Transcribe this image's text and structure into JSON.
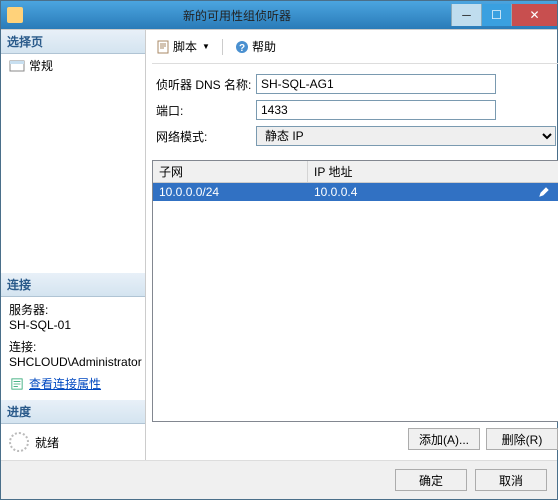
{
  "window": {
    "title": "新的可用性组侦听器"
  },
  "left": {
    "select_page": "选择页",
    "nav_general": "常规",
    "connection_hdr": "连接",
    "server_lbl": "服务器:",
    "server_val": "SH-SQL-01",
    "conn_lbl": "连接:",
    "conn_val": "SHCLOUD\\Administrator",
    "view_conn": "查看连接属性",
    "progress_hdr": "进度",
    "ready": "就绪"
  },
  "toolbar": {
    "script": "脚本",
    "help": "帮助"
  },
  "form": {
    "dns_lbl": "侦听器 DNS 名称:",
    "dns_val": "SH-SQL-AG1",
    "port_lbl": "端口:",
    "port_val": "1433",
    "netmode_lbl": "网络模式:",
    "netmode_val": "静态 IP"
  },
  "grid": {
    "col_subnet": "子网",
    "col_ip": "IP 地址",
    "row": {
      "subnet": "10.0.0.0/24",
      "ip": "10.0.0.4"
    },
    "add": "添加(A)...",
    "remove": "删除(R)"
  },
  "footer": {
    "ok": "确定",
    "cancel": "取消"
  }
}
